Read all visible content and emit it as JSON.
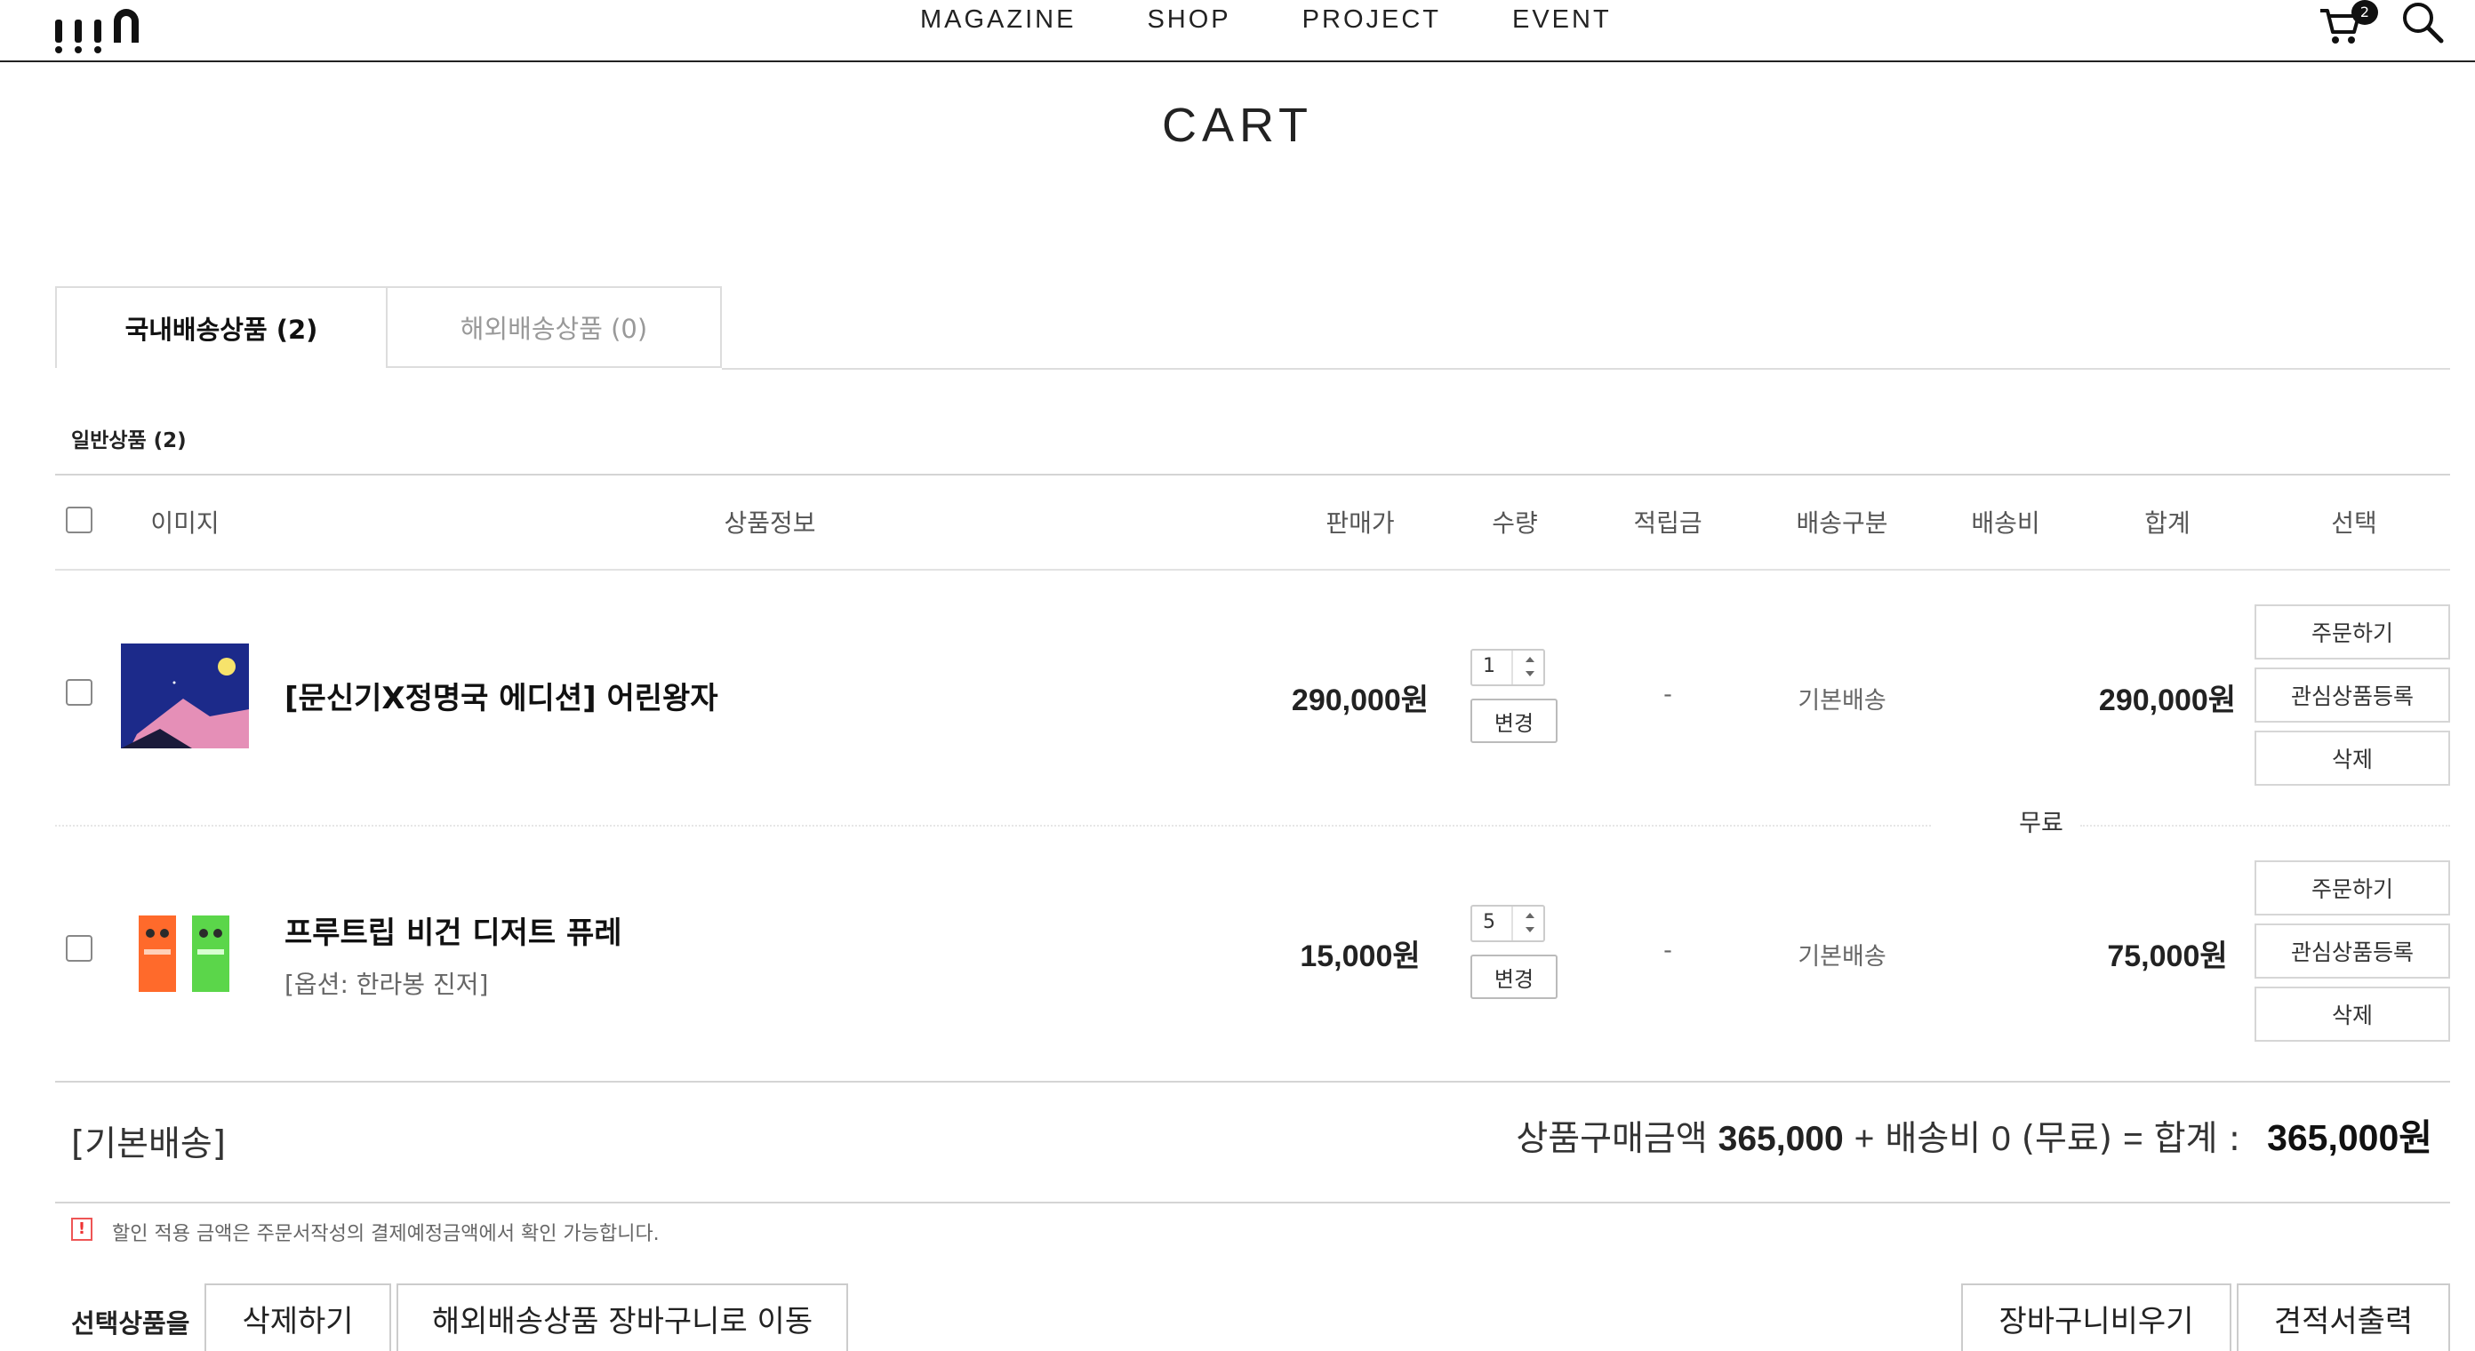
{
  "header": {
    "logo_text": "!!!n",
    "nav": [
      "MAGAZINE",
      "SHOP",
      "PROJECT",
      "EVENT"
    ],
    "cart_count": "2",
    "icons": {
      "cart": "cart-icon",
      "search": "search-icon"
    }
  },
  "page_title": "CART",
  "tabs": {
    "domestic": "국내배송상품 (2)",
    "overseas": "해외배송상품 (0)"
  },
  "section_label": "일반상품 (2)",
  "columns": {
    "image": "이미지",
    "info": "상품정보",
    "price": "판매가",
    "qty": "수량",
    "points": "적립금",
    "ship_type": "배송구분",
    "ship_fee": "배송비",
    "total": "합계",
    "select": "선택"
  },
  "items": [
    {
      "name": "[문신기X정명국 에디션] 어린왕자",
      "option": "",
      "price": "290,000원",
      "qty": "1",
      "change_label": "변경",
      "points": "-",
      "ship_type": "기본배송",
      "total": "290,000원",
      "actions": [
        "주문하기",
        "관심상품등록",
        "삭제"
      ]
    },
    {
      "name": "프루트립 비건 디저트 퓨레",
      "option": "[옵션: 한라봉 진저]",
      "price": "15,000원",
      "qty": "5",
      "change_label": "변경",
      "points": "-",
      "ship_type": "기본배송",
      "total": "75,000원",
      "actions": [
        "주문하기",
        "관심상품등록",
        "삭제"
      ]
    }
  ],
  "shipping_fee": "무료",
  "summary": {
    "group": "[기본배송]",
    "goods_label": "상품구매금액",
    "goods_amount": "365,000",
    "plus": "+",
    "fee_label": "배송비",
    "fee_amount": "0",
    "fee_note": "(무료)",
    "equals": "=",
    "total_label": "합계 :",
    "total_amount": "365,000원"
  },
  "notice": "할인 적용 금액은 주문서작성의 결제예정금액에서 확인 가능합니다.",
  "bottom": {
    "selected_label": "선택상품을",
    "delete": "삭제하기",
    "move_overseas": "해외배송상품 장바구니로 이동",
    "empty_cart": "장바구니비우기",
    "estimate": "견적서출력"
  },
  "colors": {
    "accent": "#111111",
    "border": "#dddddd",
    "notice": "#e53333"
  }
}
